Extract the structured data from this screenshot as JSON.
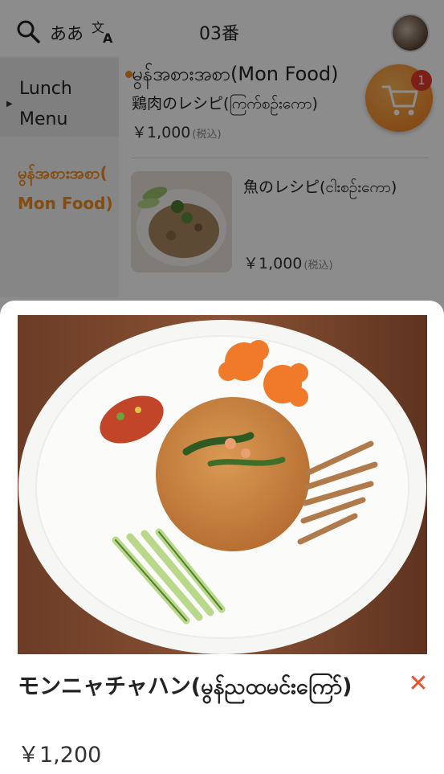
{
  "topbar": {
    "search_icon": "search-icon",
    "lang_label": "ああ",
    "translate_icon": "translate-icon",
    "title": "03番"
  },
  "sidebar": {
    "items": [
      {
        "label": "Lunch Menu",
        "active": true
      },
      {
        "label": "မွန်အစားအစာ( Mon Food)",
        "color": "#f28a1a"
      }
    ]
  },
  "menu": {
    "section_title": "မွန်အစားအစာ(Mon Food)",
    "items": [
      {
        "name": "鶏肉のレシピ(ကြက်စဉ်းကော)",
        "price": "￥1,000",
        "tax": "(税込)"
      },
      {
        "name": "魚のレシピ(ငါးစဉ်းကော)",
        "price": "￥1,000",
        "tax": "(税込)"
      }
    ]
  },
  "cart": {
    "icon": "cart-icon",
    "badge": "1"
  },
  "sheet": {
    "title": "モンニャチャハン(မွန်ညထမင်းကြော်)",
    "price": "￥1,200",
    "close_icon": "close-icon"
  },
  "colors": {
    "accent": "#f28a1a",
    "close": "#e8542d",
    "badge": "#e23a2a"
  }
}
